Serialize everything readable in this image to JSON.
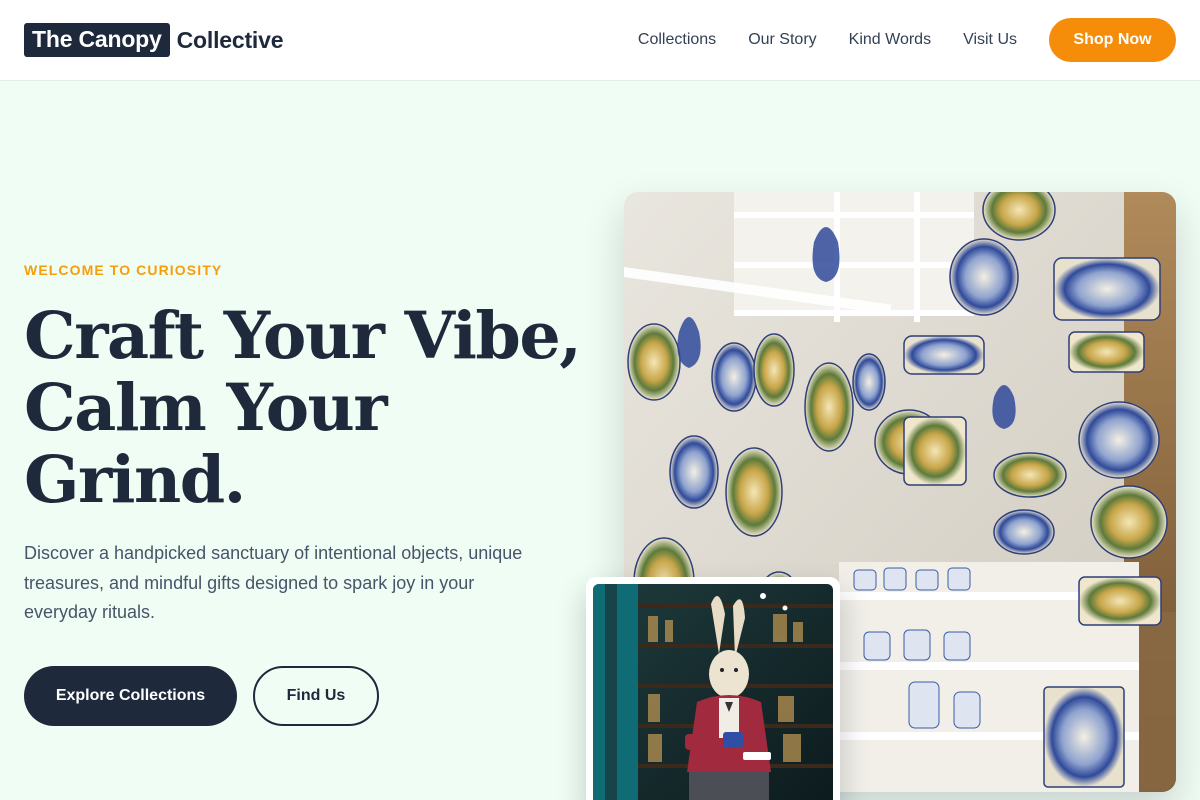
{
  "header": {
    "logo_box_text": "The Canopy",
    "logo_rest_text": "Collective",
    "nav": [
      {
        "label": "Collections"
      },
      {
        "label": "Our Story"
      },
      {
        "label": "Kind Words"
      },
      {
        "label": "Visit Us"
      }
    ],
    "cta_label": "Shop Now"
  },
  "hero": {
    "eyebrow": "WELCOME TO CURIOSITY",
    "headline_lines": [
      "Craft Your Vibe,",
      "Calm Your",
      "Grind."
    ],
    "lede": "Discover a handpicked sanctuary of intentional objects, unique treasures, and mindful gifts designed to spark joy in your everyday rituals.",
    "primary_button": "Explore Collections",
    "secondary_button": "Find Us"
  },
  "colors": {
    "navy": "#1e293b",
    "accent_orange": "#f58d0b",
    "eyebrow_amber": "#f59e0b",
    "page_mint": "#f0fdf4"
  },
  "images": {
    "main_photo": "ceramic-plates-shop-photo",
    "inset_photo": "rabbit-figure-shop-photo"
  }
}
